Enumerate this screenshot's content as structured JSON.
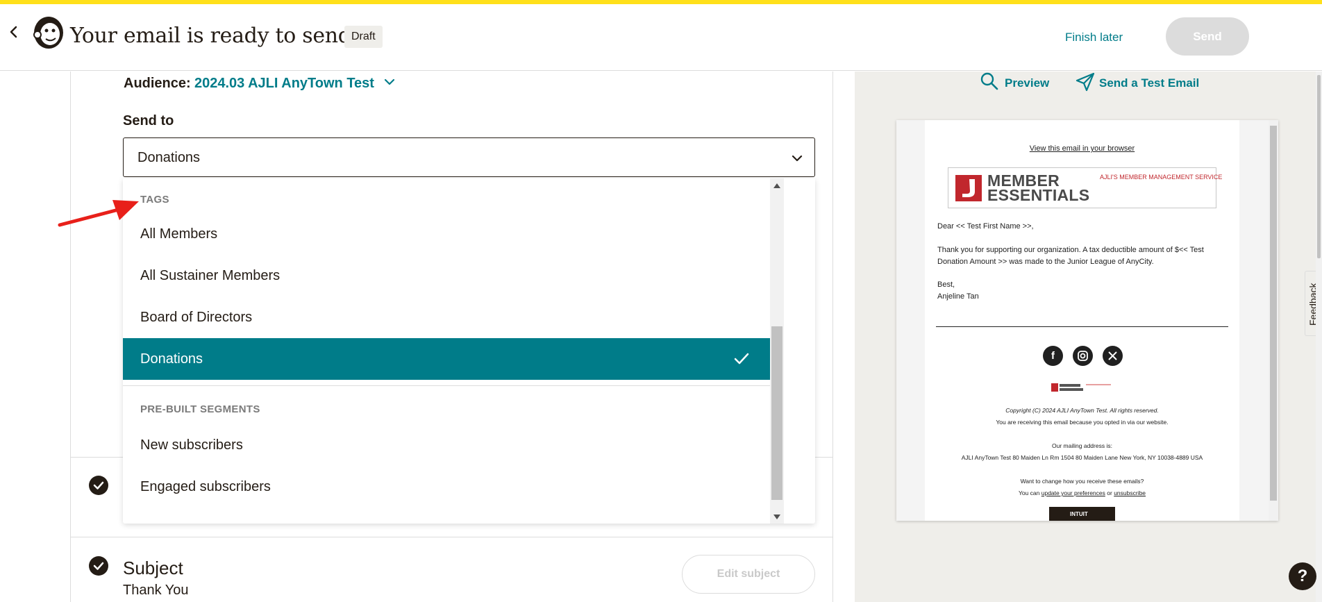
{
  "header": {
    "title": "Your email is ready to send!",
    "status_badge": "Draft",
    "finish_later": "Finish later",
    "send": "Send"
  },
  "audience": {
    "label": "Audience:",
    "value": "2024.03 AJLI AnyTown Test"
  },
  "send_to": {
    "label": "Send to",
    "selected": "Donations",
    "groups": [
      {
        "heading": "TAGS",
        "items": [
          "All Members",
          "All Sustainer Members",
          "Board of Directors",
          "Donations"
        ]
      },
      {
        "heading": "PRE-BUILT SEGMENTS",
        "items": [
          "New subscribers",
          "Engaged subscribers"
        ]
      }
    ]
  },
  "subject": {
    "heading": "Subject",
    "value": "Thank You",
    "edit_button": "Edit subject"
  },
  "preview_panel": {
    "preview": "Preview",
    "send_test": "Send a Test Email"
  },
  "email": {
    "view_link": "View this email in your browser",
    "logo_line1": "MEMBER",
    "logo_line2": "ESSENTIALS",
    "logo_tagline": "AJLI'S MEMBER MANAGEMENT SERVICE",
    "greeting": "Dear << Test First Name >>,",
    "body_line1": "Thank you for supporting our organization. A tax deductible amount of $<< Test",
    "body_line2": "Donation Amount >> was made to the Junior League of AnyCity.",
    "closing": "Best,",
    "signature": "Anjeline Tan",
    "copyright": "Copyright (C) 2024 AJLI AnyTown Test. All rights reserved.",
    "optin": "You are receiving this email because you opted in via our website.",
    "mailing_label": "Our mailing address is:",
    "mailing_address": "AJLI AnyTown Test 80 Maiden Ln Rm 1504 80 Maiden Lane New York, NY 10038-4889 USA",
    "change_q": "Want to change how you receive these emails?",
    "change_prefix": "You can",
    "update_prefs": "update your preferences",
    "or": "or",
    "unsubscribe": "unsubscribe",
    "badge": "INTUIT mailchimp"
  },
  "feedback": "Feedback",
  "help": "?",
  "colors": {
    "accent": "#007c89",
    "brand_yellow": "#ffe01b",
    "text": "#241c15",
    "annotation_arrow": "#e8201a"
  }
}
